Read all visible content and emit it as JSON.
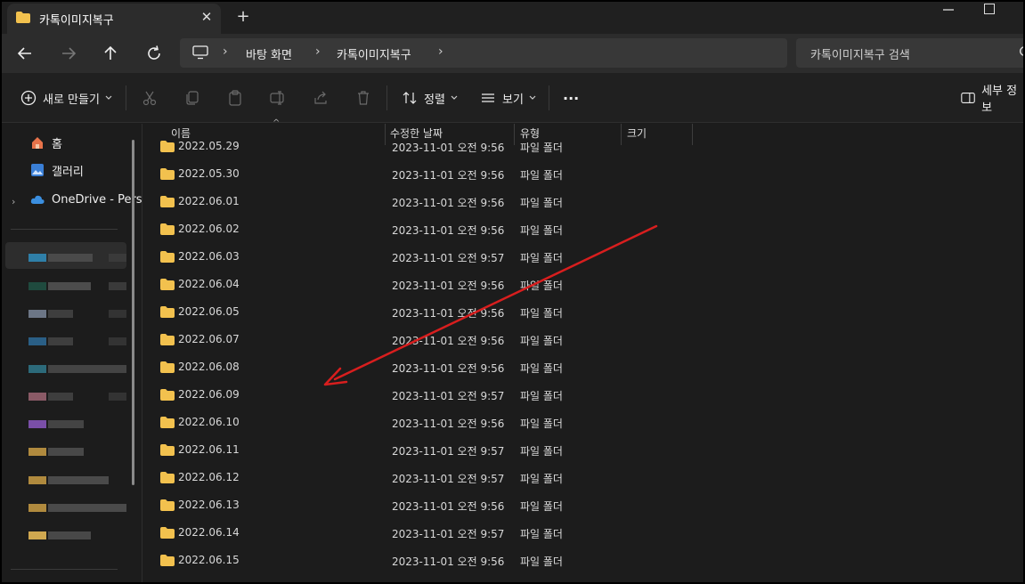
{
  "window": {
    "tab_title": "카톡이미지복구",
    "tab_close": "✕",
    "new_tab": "+"
  },
  "navigation": {
    "breadcrumbs": [
      "바탕 화면",
      "카톡이미지복구"
    ],
    "search_placeholder": "카톡이미지복구 검색"
  },
  "toolbar": {
    "new_label": "새로 만들기",
    "sort_label": "정렬",
    "view_label": "보기",
    "more_label": "···",
    "details_label": "세부 정보"
  },
  "sidebar": {
    "home": "홈",
    "gallery": "갤러리",
    "onedrive": "OneDrive - Pers"
  },
  "columns": {
    "name": "이름",
    "modified": "수정한 날짜",
    "type": "유형",
    "size": "크기"
  },
  "rows": [
    {
      "name": "2022.05.29",
      "date": "2023-11-01 오전 9:56",
      "type": "파일 폴더"
    },
    {
      "name": "2022.05.30",
      "date": "2023-11-01 오전 9:56",
      "type": "파일 폴더"
    },
    {
      "name": "2022.06.01",
      "date": "2023-11-01 오전 9:56",
      "type": "파일 폴더"
    },
    {
      "name": "2022.06.02",
      "date": "2023-11-01 오전 9:56",
      "type": "파일 폴더"
    },
    {
      "name": "2022.06.03",
      "date": "2023-11-01 오전 9:57",
      "type": "파일 폴더"
    },
    {
      "name": "2022.06.04",
      "date": "2023-11-01 오전 9:56",
      "type": "파일 폴더"
    },
    {
      "name": "2022.06.05",
      "date": "2023-11-01 오전 9:56",
      "type": "파일 폴더"
    },
    {
      "name": "2022.06.07",
      "date": "2023-11-01 오전 9:56",
      "type": "파일 폴더"
    },
    {
      "name": "2022.06.08",
      "date": "2023-11-01 오전 9:56",
      "type": "파일 폴더"
    },
    {
      "name": "2022.06.09",
      "date": "2023-11-01 오전 9:57",
      "type": "파일 폴더"
    },
    {
      "name": "2022.06.10",
      "date": "2023-11-01 오전 9:56",
      "type": "파일 폴더"
    },
    {
      "name": "2022.06.11",
      "date": "2023-11-01 오전 9:57",
      "type": "파일 폴더"
    },
    {
      "name": "2022.06.12",
      "date": "2023-11-01 오전 9:57",
      "type": "파일 폴더"
    },
    {
      "name": "2022.06.13",
      "date": "2023-11-01 오전 9:56",
      "type": "파일 폴더"
    },
    {
      "name": "2022.06.14",
      "date": "2023-11-01 오전 9:57",
      "type": "파일 폴더"
    },
    {
      "name": "2022.06.15",
      "date": "2023-11-01 오전 9:56",
      "type": "파일 폴더"
    }
  ],
  "colors": {
    "folder": "#f2c14e",
    "annotation_arrow": "#d81e1e",
    "onedrive": "#3b8fe0"
  }
}
